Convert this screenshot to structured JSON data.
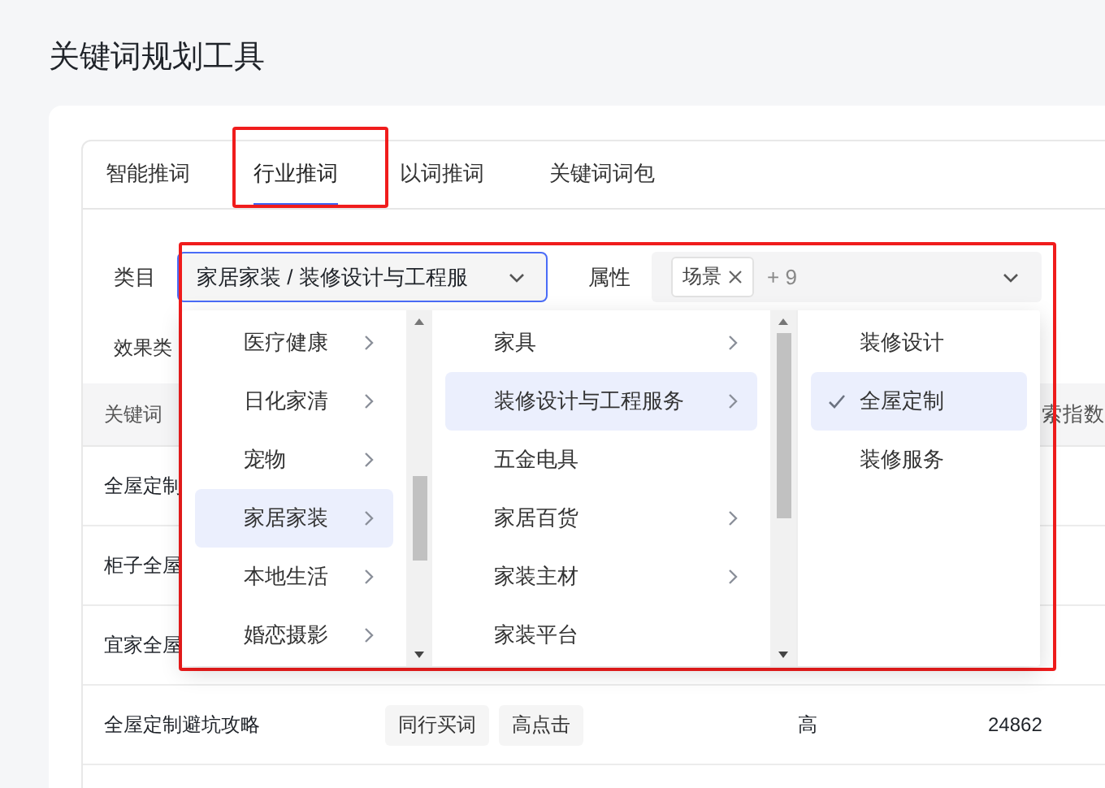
{
  "page": {
    "title": "关键词规划工具"
  },
  "tabs": [
    {
      "label": "智能推词",
      "selected": false,
      "highlighted": false
    },
    {
      "label": "行业推词",
      "selected": true,
      "highlighted": true
    },
    {
      "label": "以词推词",
      "selected": false,
      "highlighted": false
    },
    {
      "label": "关键词词包",
      "selected": false,
      "highlighted": false
    }
  ],
  "filters": {
    "highlighted": true,
    "category": {
      "label": "类目",
      "value": "家居家装 / 装修设计与工程服",
      "focused": true
    },
    "attribute": {
      "label": "属性",
      "tags": [
        "场景"
      ],
      "more": "+ 9"
    },
    "effect_label": "效果类"
  },
  "cascader": {
    "columns": [
      {
        "items": [
          {
            "label": "医疗健康",
            "has_children": true,
            "selected": false
          },
          {
            "label": "日化家清",
            "has_children": true,
            "selected": false
          },
          {
            "label": "宠物",
            "has_children": true,
            "selected": false
          },
          {
            "label": "家居家装",
            "has_children": true,
            "selected": true
          },
          {
            "label": "本地生活",
            "has_children": true,
            "selected": false
          },
          {
            "label": "婚恋摄影",
            "has_children": true,
            "selected": false
          }
        ]
      },
      {
        "items": [
          {
            "label": "家具",
            "has_children": true,
            "selected": false
          },
          {
            "label": "装修设计与工程服务",
            "has_children": true,
            "selected": true
          },
          {
            "label": "五金电具",
            "has_children": false,
            "selected": false
          },
          {
            "label": "家居百货",
            "has_children": true,
            "selected": false
          },
          {
            "label": "家装主材",
            "has_children": true,
            "selected": false
          },
          {
            "label": "家装平台",
            "has_children": false,
            "selected": false
          }
        ]
      },
      {
        "items": [
          {
            "label": "装修设计",
            "checked": false,
            "selected": false
          },
          {
            "label": "全屋定制",
            "checked": true,
            "selected": true
          },
          {
            "label": "装修服务",
            "checked": false,
            "selected": false
          }
        ]
      }
    ]
  },
  "table": {
    "header": {
      "column_1": "关键词",
      "column_4": "索指数"
    },
    "rows": [
      {
        "column_1": "全屋定制"
      },
      {
        "column_1": "柜子全屋"
      },
      {
        "column_1": "宜家全屋"
      },
      {
        "column_1": "全屋定制避坑攻略",
        "column_2": [
          "同行买词",
          "高点击"
        ],
        "column_3": "高",
        "column_4": "24862"
      }
    ]
  }
}
